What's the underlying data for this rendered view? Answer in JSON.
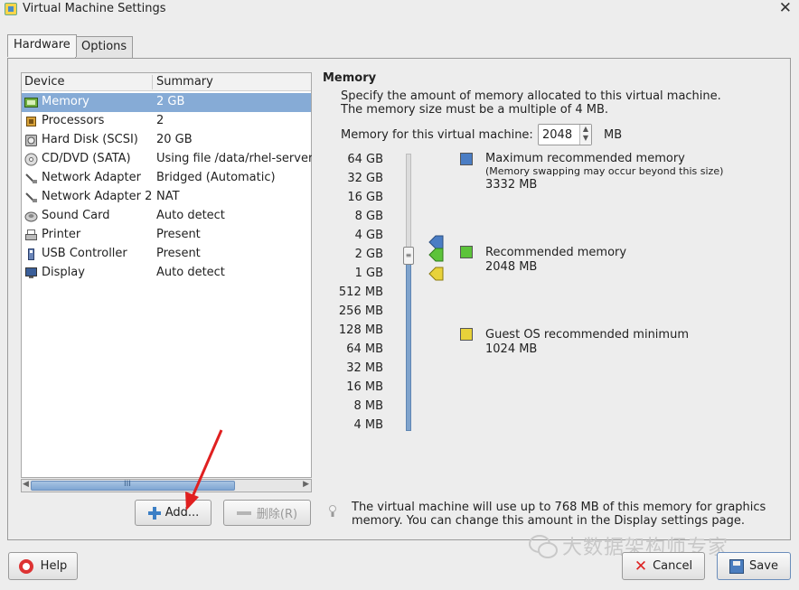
{
  "window": {
    "title": "Virtual Machine Settings",
    "close_glyph": "✕"
  },
  "tabs": [
    {
      "label": "Hardware",
      "active": true
    },
    {
      "label": "Options",
      "active": false
    }
  ],
  "device_list": {
    "columns": [
      "Device",
      "Summary"
    ],
    "rows": [
      {
        "device": "Memory",
        "summary": "2 GB",
        "icon": "memory-icon",
        "selected": true
      },
      {
        "device": "Processors",
        "summary": "2",
        "icon": "processor-icon"
      },
      {
        "device": "Hard Disk (SCSI)",
        "summary": "20 GB",
        "icon": "hard-disk-icon"
      },
      {
        "device": "CD/DVD (SATA)",
        "summary": "Using file /data/rhel-server-",
        "icon": "cdrom-icon"
      },
      {
        "device": "Network Adapter",
        "summary": "Bridged (Automatic)",
        "icon": "network-icon"
      },
      {
        "device": "Network Adapter 2",
        "summary": "NAT",
        "icon": "network-icon"
      },
      {
        "device": "Sound Card",
        "summary": "Auto detect",
        "icon": "sound-icon"
      },
      {
        "device": "Printer",
        "summary": "Present",
        "icon": "printer-icon"
      },
      {
        "device": "USB Controller",
        "summary": "Present",
        "icon": "usb-icon"
      },
      {
        "device": "Display",
        "summary": "Auto detect",
        "icon": "display-icon"
      }
    ],
    "scrollbar_grip": "III"
  },
  "buttons": {
    "add": "Add...",
    "remove": "删除(R)",
    "help": "Help",
    "cancel": "Cancel",
    "save": "Save"
  },
  "memory": {
    "title": "Memory",
    "description": "Specify the amount of memory allocated to this virtual machine. The memory size must be a multiple of 4 MB.",
    "field_label": "Memory for this virtual machine:",
    "value": "2048",
    "unit": "MB",
    "scale": [
      "64 GB",
      "32 GB",
      "16 GB",
      "8 GB",
      "4 GB",
      "2 GB",
      "1 GB",
      "512 MB",
      "256 MB",
      "128 MB",
      "64 MB",
      "32 MB",
      "16 MB",
      "8 MB",
      "4 MB"
    ],
    "legend": {
      "max": {
        "title": "Maximum recommended memory",
        "note": "(Memory swapping may occur beyond this size)",
        "value": "3332 MB",
        "color": "#4a7dc4"
      },
      "recommended": {
        "title": "Recommended memory",
        "value": "2048 MB",
        "color": "#5cc33a"
      },
      "minimum": {
        "title": "Guest OS recommended minimum",
        "value": "1024 MB",
        "color": "#e8d23a"
      }
    },
    "info": "The virtual machine will use up to 768 MB of this memory for graphics memory. You can change this amount in the Display settings page."
  },
  "watermark": "大数据架构师专家"
}
